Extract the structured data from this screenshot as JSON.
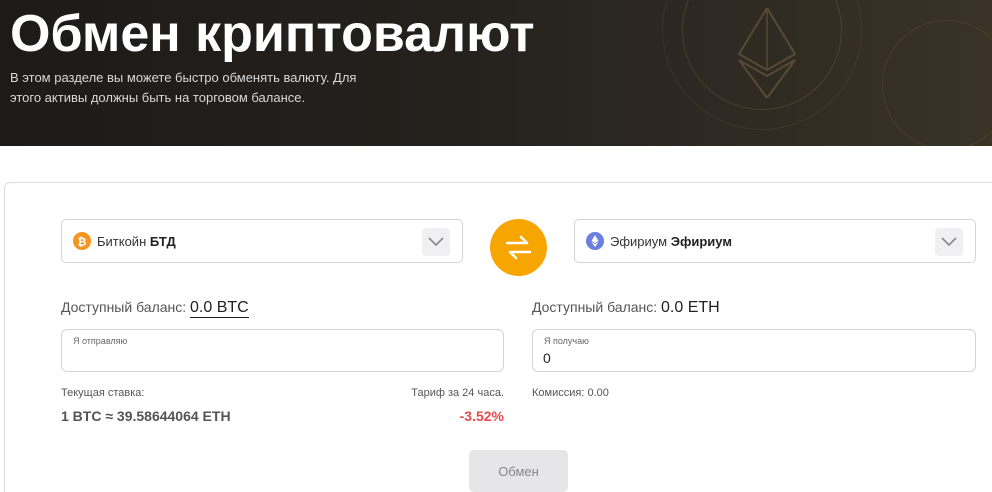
{
  "header": {
    "title": "Обмен криптовалют",
    "description": "В этом разделе вы можете быстро обменять валюту. Для этого активы должны быть на торговом балансе."
  },
  "exchange": {
    "from": {
      "coin_icon": "bitcoin-icon",
      "name": "Биткойн",
      "ticker": "БТД",
      "balance_label": "Доступный баланс:",
      "balance_value": "0.0 BTC",
      "input_label": "Я отправляю",
      "input_value": ""
    },
    "to": {
      "coin_icon": "ethereum-icon",
      "name": "Эфириум",
      "ticker": "Эфириум",
      "balance_label": "Доступный баланс:",
      "balance_value": "0.0 ETH",
      "input_label": "Я получаю",
      "input_value": "0"
    },
    "rate_label": "Текущая ставка:",
    "rate_value": "1 BTC ≈ 39.58644064 ETH",
    "tariff_label": "Тариф за 24 часа.",
    "tariff_value": "-3.52%",
    "commission": "Комиссия: 0.00",
    "submit_label": "Обмен"
  },
  "colors": {
    "accent": "#f7a500",
    "negative": "#e44b4b",
    "btc": "#f5951d",
    "eth": "#6b7fe0"
  }
}
